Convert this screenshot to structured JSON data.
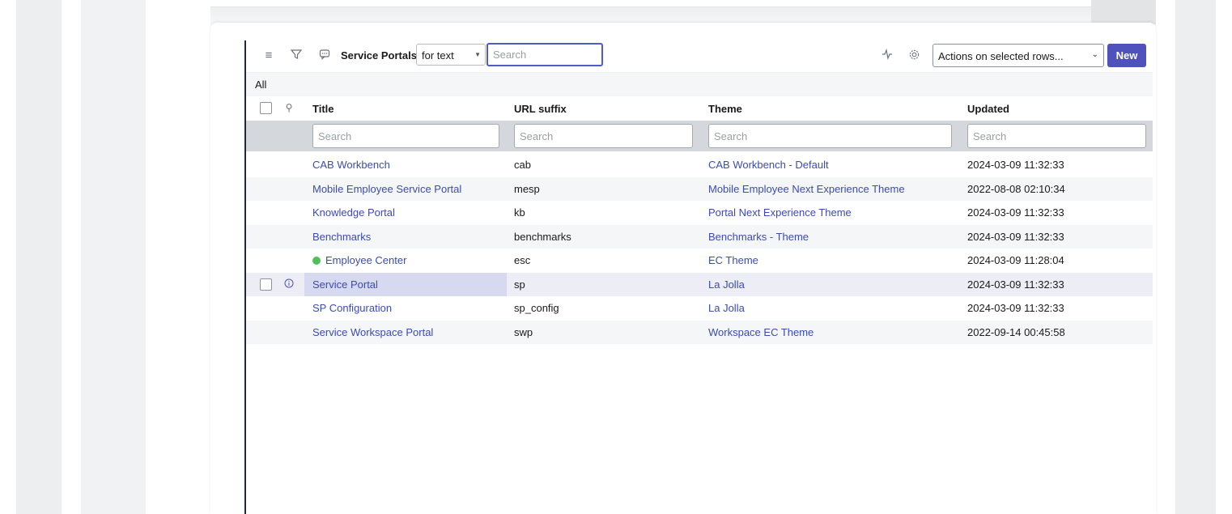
{
  "toolbar": {
    "list_title": "Service Portals",
    "search_field": "for text",
    "search_placeholder": "Search",
    "actions_label": "Actions on selected rows...",
    "new_label": "New",
    "icons": [
      "menu-icon",
      "filter-icon",
      "comment-icon",
      "activity-icon",
      "gear-icon"
    ]
  },
  "breadcrumb": "All",
  "columns": [
    "Title",
    "URL suffix",
    "Theme",
    "Updated"
  ],
  "column_search_placeholder": "Search",
  "rows": [
    {
      "title": "CAB Workbench",
      "url_suffix": "cab",
      "theme": "CAB Workbench - Default",
      "updated": "2024-03-09 11:32:33"
    },
    {
      "title": "Mobile Employee Service Portal",
      "url_suffix": "mesp",
      "theme": "Mobile Employee Next Experience Theme",
      "updated": "2022-08-08 02:10:34"
    },
    {
      "title": "Knowledge Portal",
      "url_suffix": "kb",
      "theme": "Portal Next Experience Theme",
      "updated": "2024-03-09 11:32:33"
    },
    {
      "title": "Benchmarks",
      "url_suffix": "benchmarks",
      "theme": "Benchmarks - Theme",
      "updated": "2024-03-09 11:32:33"
    },
    {
      "title": "Employee Center",
      "url_suffix": "esc",
      "theme": "EC Theme",
      "updated": "2024-03-09 11:28:04",
      "status": "green"
    },
    {
      "title": "Service Portal",
      "url_suffix": "sp",
      "theme": "La Jolla",
      "updated": "2024-03-09 11:32:33",
      "selected": true
    },
    {
      "title": "SP Configuration",
      "url_suffix": "sp_config",
      "theme": "La Jolla",
      "updated": "2024-03-09 11:32:33"
    },
    {
      "title": "Service Workspace Portal",
      "url_suffix": "swp",
      "theme": "Workspace EC Theme",
      "updated": "2022-09-14 00:45:58"
    }
  ],
  "colors": {
    "accent": "#4f52bd",
    "link": "#3b4bb3",
    "status_green": "#4fbf5a",
    "selected_row": "#d6d9f0"
  }
}
